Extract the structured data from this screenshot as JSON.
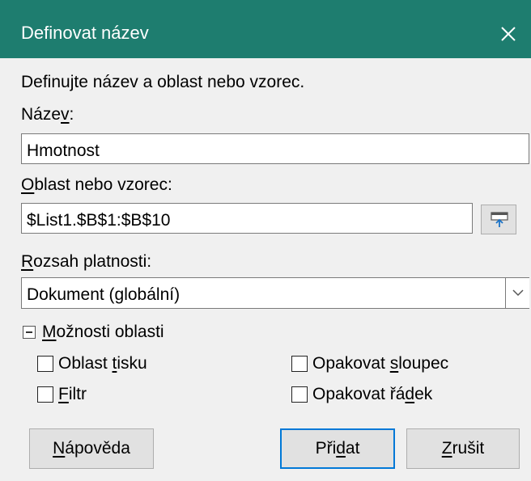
{
  "window": {
    "title": "Definovat název",
    "close_icon": "close-icon"
  },
  "dialog": {
    "intro": "Definujte název a oblast nebo vzorec.",
    "name_label": {
      "prefix": "Náze",
      "mnemonic": "v",
      "suffix": ":"
    },
    "name_value": "Hmotnost",
    "range_label": {
      "mnemonic": "O",
      "rest": "blast nebo vzorec:"
    },
    "range_value": "$List1.$B$1:$B$10",
    "shrink_icon": "shrink-icon",
    "scope_label": {
      "mnemonic": "R",
      "rest": "ozsah platnosti:"
    },
    "scope_value": "Dokument (globální)",
    "scope_dropdown_icon": "chevron-down-icon",
    "range_options": {
      "expanded": true,
      "header": {
        "prefix": "",
        "mnemonic": "M",
        "rest": "ožnosti oblasti"
      },
      "print_range": {
        "prefix": "Oblast ",
        "mnemonic": "t",
        "rest": "isku",
        "checked": false
      },
      "filter": {
        "prefix": "",
        "mnemonic": "F",
        "rest": "iltr",
        "checked": false
      },
      "repeat_column": {
        "prefix": "Opakovat ",
        "mnemonic": "s",
        "rest": "loupec",
        "checked": false
      },
      "repeat_row": {
        "prefix": "Opakovat řá",
        "mnemonic": "d",
        "rest": "ek",
        "checked": false
      }
    }
  },
  "buttons": {
    "help": {
      "prefix": "",
      "mnemonic": "N",
      "rest": "ápověda"
    },
    "add": {
      "prefix": "Při",
      "mnemonic": "d",
      "rest": "at"
    },
    "cancel": {
      "prefix": "",
      "mnemonic": "Z",
      "rest": "rušit"
    }
  },
  "colors": {
    "titlebar": "#1e7d6f",
    "background": "#f0f0f0",
    "default_button_border": "#0078d7"
  }
}
